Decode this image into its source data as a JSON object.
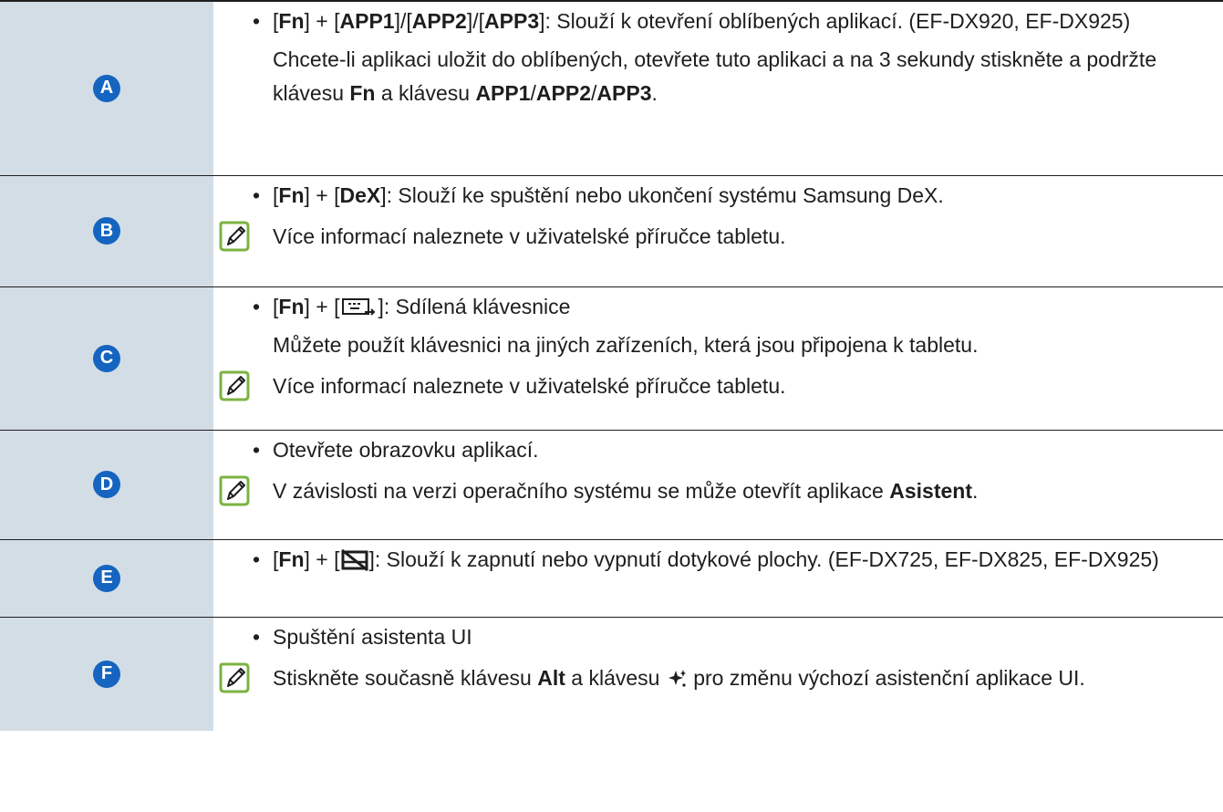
{
  "rows": [
    {
      "badge": "A",
      "line1": {
        "open1": "[",
        "k1": "Fn",
        "close1": "] + [",
        "k2": "APP1",
        "sep1": "]/[",
        "k3": "APP2",
        "sep2": "]/[",
        "k4": "APP3",
        "rest": "]: Slouží k otevření oblíbených aplikací. (EF-DX920, EF-DX925)"
      },
      "para": {
        "pre": "Chcete-li aplikaci uložit do oblíbených, otevřete tuto aplikaci a na 3 sekundy stiskněte a podržte klávesu ",
        "k1": "Fn",
        "mid": " a klávesu ",
        "k2": "APP1",
        "s1": "/",
        "k3": "APP2",
        "s2": "/",
        "k4": "APP3",
        "end": "."
      }
    },
    {
      "badge": "B",
      "line1": {
        "open1": "[",
        "k1": "Fn",
        "close1": "] + [",
        "k2": "DeX",
        "rest": "]: Slouží ke spuštění nebo ukončení systému Samsung DeX."
      },
      "note": "Více informací naleznete v uživatelské příručce tabletu."
    },
    {
      "badge": "C",
      "line1": {
        "open1": "[",
        "k1": "Fn",
        "close1": "] + [",
        "rest": "]: Sdílená klávesnice"
      },
      "para": "Můžete použít klávesnici na jiných zařízeních, která jsou připojena k tabletu.",
      "note": "Více informací naleznete v uživatelské příručce tabletu."
    },
    {
      "badge": "D",
      "line1": "Otevřete obrazovku aplikací.",
      "note": {
        "pre": "V závislosti na verzi operačního systému se může otevřít aplikace ",
        "k1": "Asistent",
        "end": "."
      }
    },
    {
      "badge": "E",
      "line1": {
        "open1": "[",
        "k1": "Fn",
        "close1": "] + [",
        "rest": "]: Slouží k zapnutí nebo vypnutí dotykové plochy. (EF-DX725, EF-DX825, EF-DX925)"
      }
    },
    {
      "badge": "F",
      "line1": "Spuštění asistenta UI",
      "note": {
        "pre": "Stiskněte současně klávesu ",
        "k1": "Alt",
        "mid": " a klávesu ",
        "end": " pro změnu výchozí asistenční aplikace UI."
      }
    }
  ],
  "colors": {
    "badge": "#1565c0",
    "label_bg": "#d3dde6",
    "note_icon": "#7cb342"
  },
  "icons": [
    "note-icon",
    "share-keyboard-icon",
    "touchpad-off-icon",
    "ai-sparkle-icon"
  ]
}
